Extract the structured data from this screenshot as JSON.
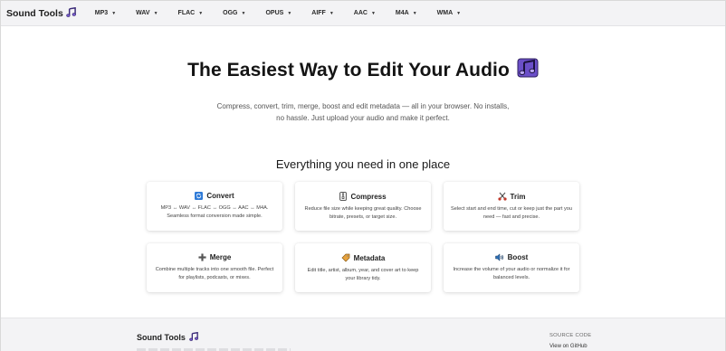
{
  "brand": {
    "name": "Sound Tools",
    "icon": "music-note-icon"
  },
  "nav": [
    {
      "label": "MP3"
    },
    {
      "label": "WAV"
    },
    {
      "label": "FLAC"
    },
    {
      "label": "OGG"
    },
    {
      "label": "OPUS"
    },
    {
      "label": "AIFF"
    },
    {
      "label": "AAC"
    },
    {
      "label": "M4A"
    },
    {
      "label": "WMA"
    }
  ],
  "hero": {
    "title": "The Easiest Way to Edit Your Audio",
    "subtitle": "Compress, convert, trim, merge, boost and edit metadata — all in your browser. No installs, no hassle. Just upload your audio and make it perfect."
  },
  "features": {
    "title": "Everything you need in one place",
    "cards": [
      {
        "title": "Convert",
        "icon": "convert-icon",
        "desc": "MP3 ↔ WAV ↔ FLAC ↔ OGG ↔ AAC ↔ M4A. Seamless format conversion made simple."
      },
      {
        "title": "Compress",
        "icon": "compress-icon",
        "desc": "Reduce file size while keeping great quality. Choose bitrate, presets, or target size."
      },
      {
        "title": "Trim",
        "icon": "scissors-icon",
        "desc": "Select start and end time, cut or keep just the part you need — fast and precise."
      },
      {
        "title": "Merge",
        "icon": "merge-icon",
        "desc": "Combine multiple tracks into one smooth file. Perfect for playlists, podcasts, or mixes."
      },
      {
        "title": "Metadata",
        "icon": "tag-icon",
        "desc": "Edit title, artist, album, year, and cover art to keep your library tidy."
      },
      {
        "title": "Boost",
        "icon": "speaker-icon",
        "desc": "Increase the volume of your audio or normalize it for balanced levels."
      }
    ]
  },
  "footer": {
    "brand": "Sound Tools",
    "source_heading": "SOURCE CODE",
    "github_link": "View on GitHub"
  },
  "colors": {
    "accent_purple": "#6b4fc8",
    "convert_blue": "#2f7bd8",
    "nav_bg": "#f3f3f5"
  }
}
